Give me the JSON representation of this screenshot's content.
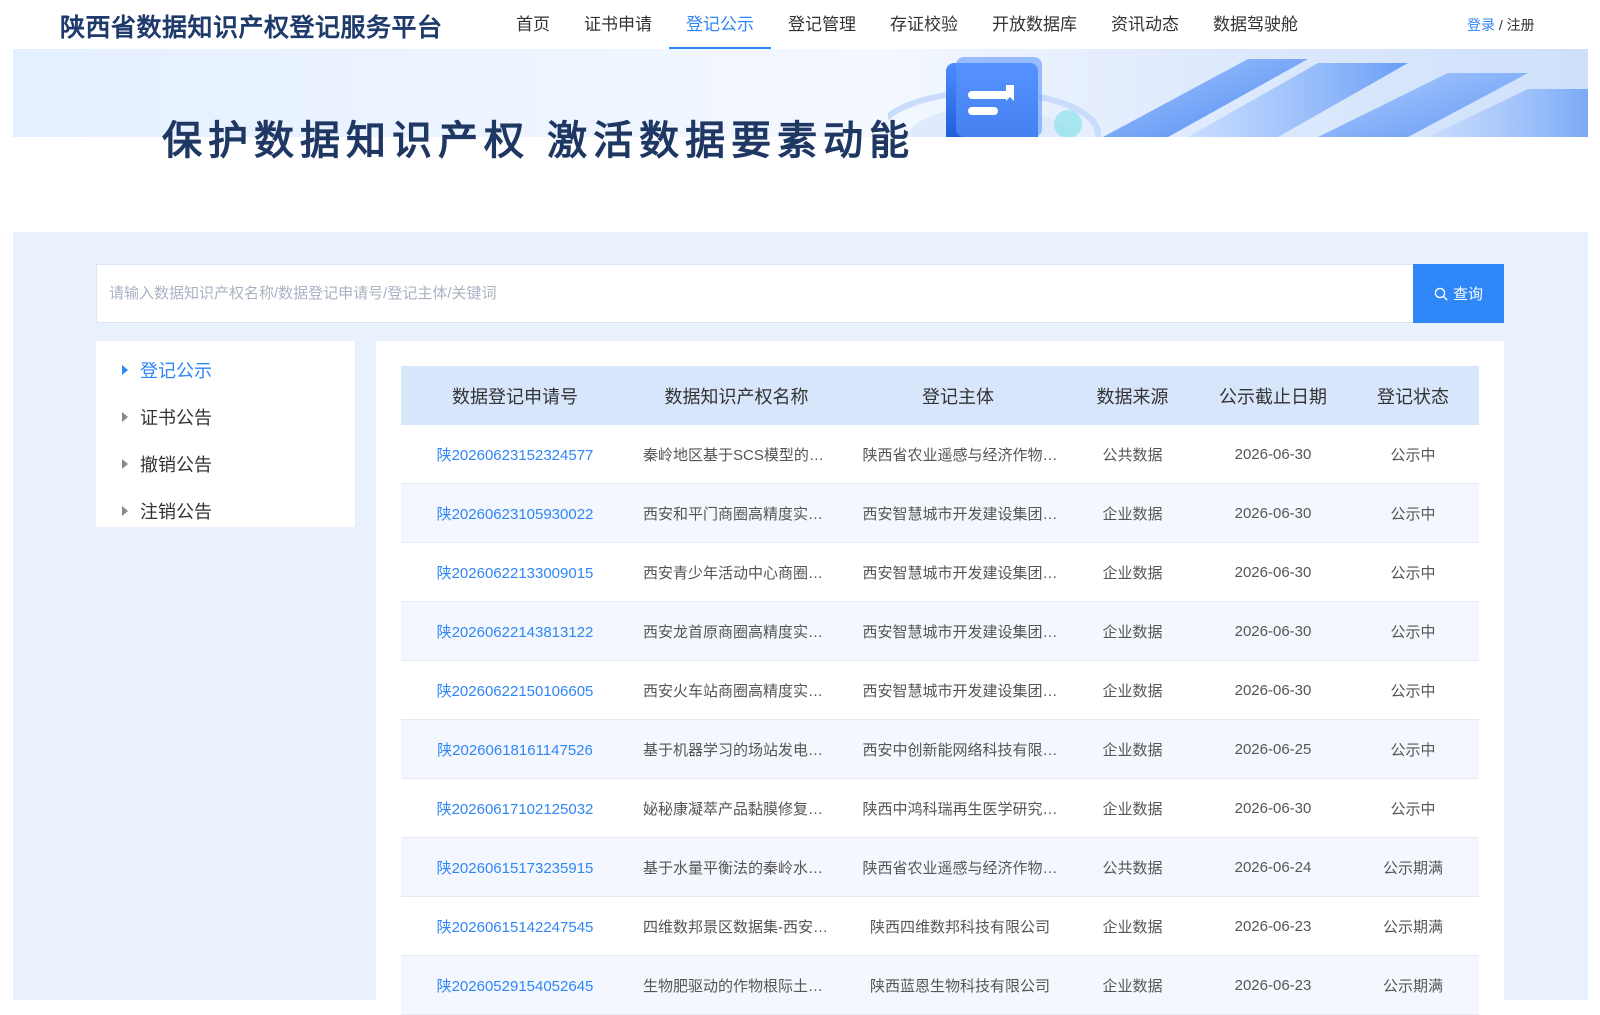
{
  "header": {
    "brand": "陕西省数据知识产权登记服务平台",
    "nav": [
      "首页",
      "证书申请",
      "登记公示",
      "登记管理",
      "存证校验",
      "开放数据库",
      "资讯动态",
      "数据驾驶舱"
    ],
    "active_nav": "登记公示",
    "login": "登录",
    "separator": " / ",
    "register": "注册"
  },
  "banner": {
    "slogan": "保护数据知识产权 激活数据要素动能"
  },
  "search": {
    "placeholder": "请输入数据知识产权名称/数据登记申请号/登记主体/关键词",
    "value": "",
    "button": "查询"
  },
  "sidebar": {
    "items": [
      {
        "label": "登记公示",
        "active": true
      },
      {
        "label": "证书公告",
        "active": false
      },
      {
        "label": "撤销公告",
        "active": false
      },
      {
        "label": "注销公告",
        "active": false
      }
    ]
  },
  "table": {
    "headers": [
      "数据登记申请号",
      "数据知识产权名称",
      "登记主体",
      "数据来源",
      "公示截止日期",
      "登记状态"
    ],
    "rows": [
      {
        "regno": "陕20260623152324577",
        "name": "秦岭地区基于SCS模型的径…",
        "owner": "陕西省农业遥感与经济作物…",
        "source": "公共数据",
        "deadline": "2026-06-30",
        "status": "公示中"
      },
      {
        "regno": "陕20260623105930022",
        "name": "西安和平门商圈高精度实景…",
        "owner": "西安智慧城市开发建设集团…",
        "source": "企业数据",
        "deadline": "2026-06-30",
        "status": "公示中"
      },
      {
        "regno": "陕20260622133009015",
        "name": "西安青少年活动中心商圈高…",
        "owner": "西安智慧城市开发建设集团…",
        "source": "企业数据",
        "deadline": "2026-06-30",
        "status": "公示中"
      },
      {
        "regno": "陕20260622143813122",
        "name": "西安龙首原商圈高精度实景…",
        "owner": "西安智慧城市开发建设集团…",
        "source": "企业数据",
        "deadline": "2026-06-30",
        "status": "公示中"
      },
      {
        "regno": "陕20260622150106605",
        "name": "西安火车站商圈高精度实景…",
        "owner": "西安智慧城市开发建设集团…",
        "source": "企业数据",
        "deadline": "2026-06-30",
        "status": "公示中"
      },
      {
        "regno": "陕20260618161147526",
        "name": "基于机器学习的场站发电预…",
        "owner": "西安中创新能网络科技有限…",
        "source": "企业数据",
        "deadline": "2026-06-25",
        "status": "公示中"
      },
      {
        "regno": "陕20260617102125032",
        "name": "妼秘康凝萃产品黏膜修复功…",
        "owner": "陕西中鸿科瑞再生医学研究…",
        "source": "企业数据",
        "deadline": "2026-06-30",
        "status": "公示中"
      },
      {
        "regno": "陕20260615173235915",
        "name": "基于水量平衡法的秦岭水源…",
        "owner": "陕西省农业遥感与经济作物…",
        "source": "公共数据",
        "deadline": "2026-06-24",
        "status": "公示期满"
      },
      {
        "regno": "陕20260615142247545",
        "name": "四维数邦景区数据集-西安市…",
        "owner": "陕西四维数邦科技有限公司",
        "source": "企业数据",
        "deadline": "2026-06-23",
        "status": "公示期满"
      },
      {
        "regno": "陕20260529154052645",
        "name": "生物肥驱动的作物根际土壤…",
        "owner": "陕西蓝恩生物科技有限公司",
        "source": "企业数据",
        "deadline": "2026-06-23",
        "status": "公示期满"
      }
    ]
  },
  "colors": {
    "accent": "#2f86f6",
    "brand_text": "#1f3b6b",
    "page_bg": "#e9f1fc",
    "table_header_bg": "#d7e6fb"
  }
}
